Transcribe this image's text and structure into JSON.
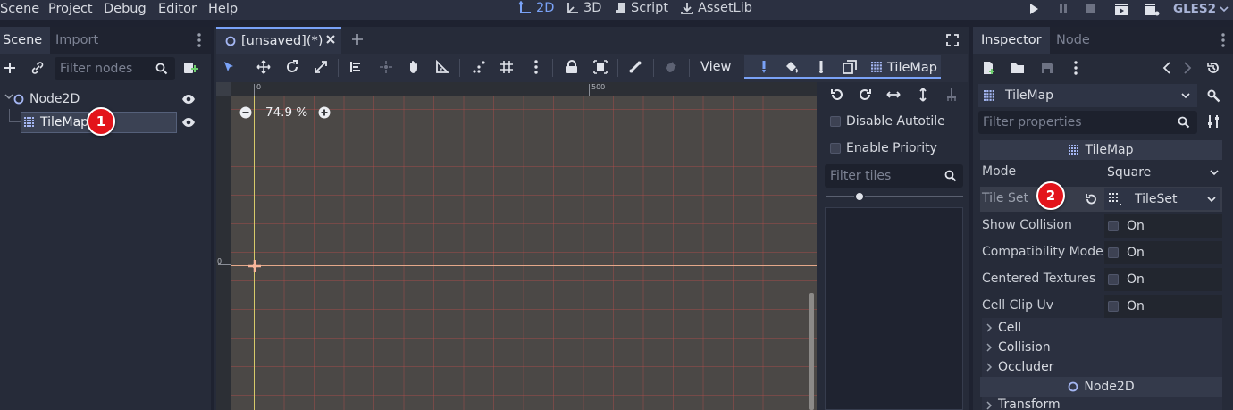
{
  "menu": [
    "Scene",
    "Project",
    "Debug",
    "Editor",
    "Help"
  ],
  "workspaces": [
    {
      "label": "2D",
      "icon": "2d-icon",
      "active": true
    },
    {
      "label": "3D",
      "icon": "3d-icon",
      "active": false
    },
    {
      "label": "Script",
      "icon": "script-icon",
      "active": false
    },
    {
      "label": "AssetLib",
      "icon": "assetlib-icon",
      "active": false
    }
  ],
  "renderer": "GLES2",
  "scene_dock": {
    "tabs": [
      "Scene",
      "Import"
    ],
    "filter_placeholder": "Filter nodes",
    "tree": [
      {
        "name": "Node2D",
        "icon": "node2d-icon"
      },
      {
        "name": "TileMap",
        "icon": "tilemap-icon"
      }
    ]
  },
  "editor": {
    "scene_tab": "[unsaved](*)",
    "view_label": "View",
    "tilemap_label": "TileMap",
    "zoom": "74.9 %",
    "ruler_labels": [
      "0",
      "500"
    ],
    "ruler_left_label": "0"
  },
  "tile_panel": {
    "disable_autotile": "Disable Autotile",
    "enable_priority": "Enable Priority",
    "filter_placeholder": "Filter tiles"
  },
  "inspector": {
    "tabs": [
      "Inspector",
      "Node"
    ],
    "object": "TileMap",
    "filter_placeholder": "Filter properties",
    "section_tilemap": "TileMap",
    "properties": [
      {
        "label": "Mode",
        "value": "Square"
      },
      {
        "label": "Tile Set",
        "value": "TileSet"
      },
      {
        "label": "Show Collision",
        "value": "On"
      },
      {
        "label": "Compatibility Mode",
        "value": "On"
      },
      {
        "label": "Centered Textures",
        "value": "On"
      },
      {
        "label": "Cell Clip Uv",
        "value": "On"
      }
    ],
    "groups": [
      "Cell",
      "Collision",
      "Occluder"
    ],
    "section_node2d": "Node2D",
    "transform": "Transform"
  },
  "badges": [
    "1",
    "2"
  ],
  "colors": {
    "accent": "#7aa2f7",
    "badge": "#e3141b",
    "viewport": "#4b4846"
  }
}
